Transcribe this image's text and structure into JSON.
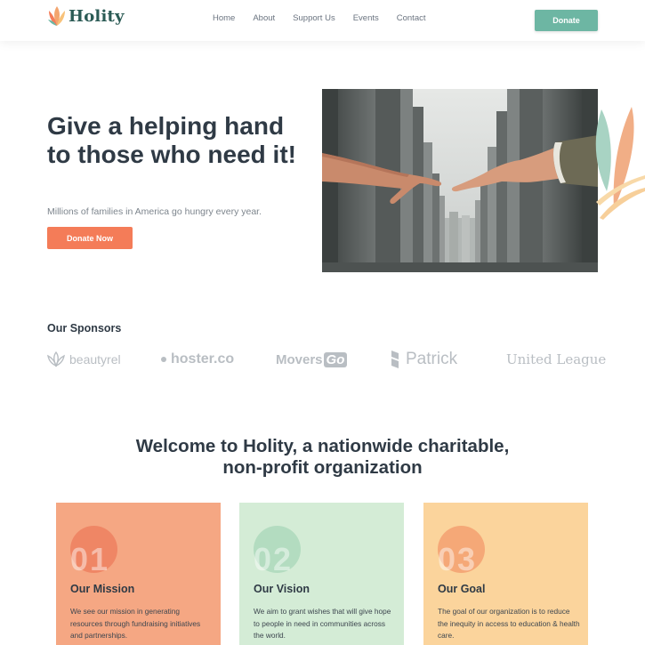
{
  "header": {
    "logo_text": "Holity",
    "nav": [
      "Home",
      "About",
      "Support Us",
      "Events",
      "Contact"
    ],
    "donate_label": "Donate"
  },
  "hero": {
    "title": "Give a helping hand to those who need it!",
    "subtitle": "Millions of families in America go hungry every year.",
    "button_label": "Donate Now"
  },
  "sponsors": {
    "title": "Our Sponsors",
    "items": [
      {
        "name": "beautyrel"
      },
      {
        "name": "hoster.co"
      },
      {
        "name_part1": "Movers",
        "name_part2": "Go"
      },
      {
        "name": "Patrick"
      },
      {
        "name": "United League"
      }
    ]
  },
  "welcome": {
    "line1": "Welcome to Holity, a nationwide charitable,",
    "line2": "non-profit organization"
  },
  "cards": [
    {
      "number": "01",
      "title": "Our Mission",
      "text": "We see our mission in generating resources through fundraising initiatives and partnerships."
    },
    {
      "number": "02",
      "title": "Our Vision",
      "text": "We aim to grant wishes that will give hope to people in need in communities across the world."
    },
    {
      "number": "03",
      "title": "Our Goal",
      "text": "The goal of our organization is to reduce the inequity in access to education & health care."
    }
  ],
  "colors": {
    "brand_green": "#6db6a3",
    "accent_orange": "#f47c58",
    "mission_card": "#f5a783",
    "vision_card": "#d4ecd6",
    "goal_card": "#fbd49c"
  }
}
